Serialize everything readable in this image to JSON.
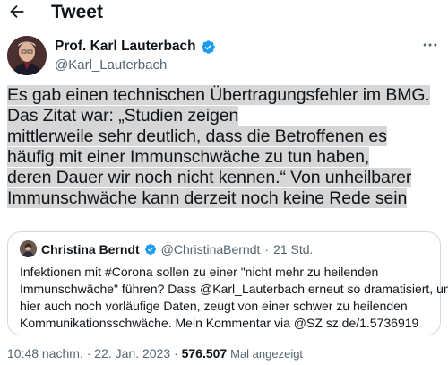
{
  "header": {
    "title": "Tweet",
    "back_icon": "arrow-left-icon"
  },
  "author": {
    "name": "Prof. Karl Lauterbach",
    "handle": "@Karl_Lauterbach",
    "verified_icon": "verified-badge-icon",
    "more_icon": "more-horizontal-icon"
  },
  "tweet": {
    "lines": [
      "Es gab einen technischen Übertragungsfehler im BMG.",
      "Das Zitat war: „Studien zeigen",
      "mittlerweile sehr deutlich, dass die Betroffenen es",
      "häufig mit einer Immunschwäche zu tun haben,",
      "deren Dauer wir noch nicht kennen.“ Von unheilbarer",
      "Immunschwäche kann derzeit noch keine Rede sein"
    ]
  },
  "quote": {
    "name": "Christina Berndt",
    "handle": "@ChristinaBerndt",
    "separator": "·",
    "time": "21 Std.",
    "lines": [
      "Infektionen mit #Corona sollen zu einer \"nicht mehr zu heilenden",
      "Immunschwäche\" führen? Dass @Karl_Lauterbach erneut so dramatisiert, und",
      "hier auch noch vorläufige Daten, zeugt von einer schwer zu heilenden",
      "Kommunikationsschwäche. Mein Kommentar via @SZ sz.de/1.5736919"
    ]
  },
  "meta": {
    "time": "10:48 nachm.",
    "separator": "·",
    "date": "22. Jan. 2023",
    "separator2": "·",
    "views": "576.507",
    "views_label": "Mal angezeigt"
  },
  "colors": {
    "accent": "#1d9bf0",
    "highlight": "#d6d6d6",
    "muted": "#536471"
  }
}
